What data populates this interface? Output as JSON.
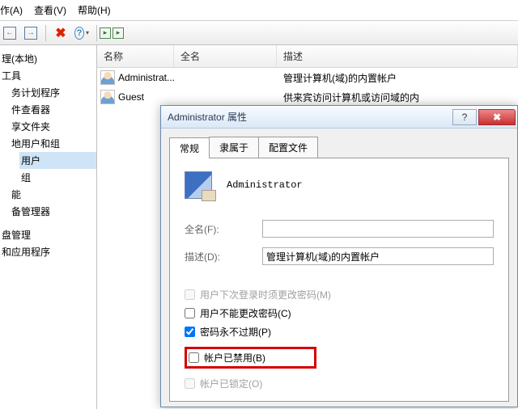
{
  "menu": {
    "action": "作(A)",
    "view": "查看(V)",
    "help": "帮助(H)"
  },
  "tree": {
    "root": "理(本地)",
    "tools": "工具",
    "sched": "务计划程序",
    "evt": "件查看器",
    "shared": "享文件夹",
    "localusers": "地用户和组",
    "users": "用户",
    "groups": "组",
    "perf": "能",
    "devmgr": "备管理器",
    "disk": "盘管理",
    "apps": "和应用程序"
  },
  "columns": {
    "name": "名称",
    "fullname": "全名",
    "desc": "描述"
  },
  "rows": [
    {
      "name": "Administrat...",
      "full": "",
      "desc": "管理计算机(域)的内置帐户"
    },
    {
      "name": "Guest",
      "full": "",
      "desc": "供来宾访问计算机或访问域的内"
    }
  ],
  "dialog": {
    "title": "Administrator 属性",
    "tabs": {
      "general": "常规",
      "member": "隶属于",
      "profile": "配置文件"
    },
    "account": "Administrator",
    "fullname_lbl": "全名(F):",
    "fullname_val": "",
    "desc_lbl": "描述(D):",
    "desc_val": "管理计算机(域)的内置帐户",
    "chk_mustchange": "用户下次登录时须更改密码(M)",
    "chk_cannotchange": "用户不能更改密码(C)",
    "chk_neverexpire": "密码永不过期(P)",
    "chk_disabled": "帐户已禁用(B)",
    "chk_locked": "帐户已锁定(O)"
  }
}
